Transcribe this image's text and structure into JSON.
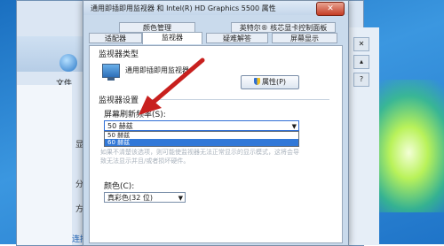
{
  "background_window": {
    "file_menu": "文件",
    "labels": [
      "显",
      "分",
      "方"
    ],
    "link": "连接"
  },
  "dialog": {
    "title": "通用即插即用监视器 和 Intel(R) HD Graphics 5500 属性",
    "close_symbol": "✕",
    "tabs_row1": [
      "颜色管理",
      "英特尔® 核芯显卡控制面板"
    ],
    "tabs_row2": [
      "适配器",
      "监视器",
      "疑难解答",
      "屏幕显示"
    ],
    "active_tab": "监视器",
    "monitor_type_label": "监视器类型",
    "monitor_name": "通用即插即用监视器",
    "properties_button": "属性(P)",
    "monitor_settings_label": "监视器设置",
    "refresh_rate_label": "屏幕刷新频率(S):",
    "refresh_rate_value": "50 赫兹",
    "refresh_options": [
      "50 赫兹",
      "60 赫兹"
    ],
    "selected_option_index": 1,
    "warning_text": "如果不清楚该选项，则可能使监视器无法正常显示的显示模式，这将会导致无法显示并且/或者损坏硬件。",
    "color_label": "颜色(C):",
    "color_value": "真彩色(32 位)"
  },
  "colors": {
    "accent": "#3178d8",
    "arrow": "#c8201e"
  }
}
